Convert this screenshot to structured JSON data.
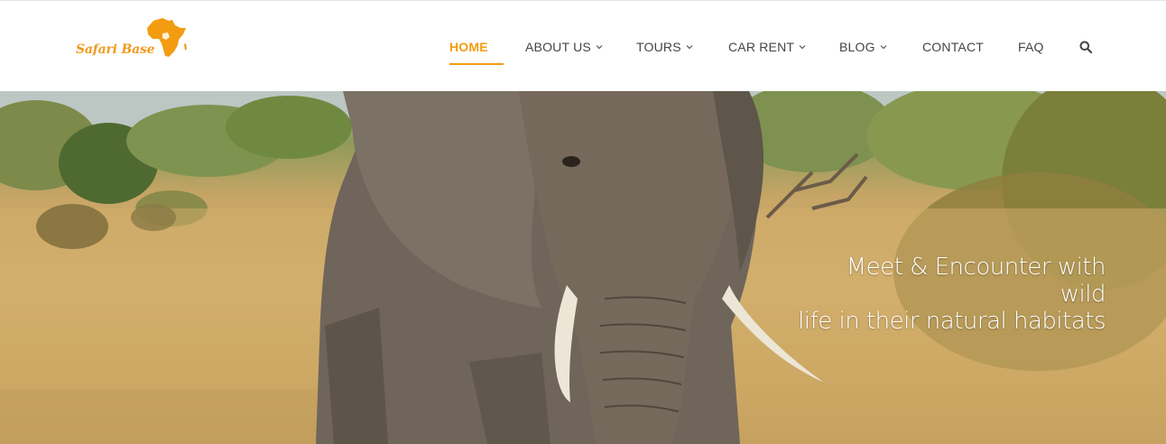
{
  "brand": {
    "name": "Safari Base",
    "accent_color": "#f39c12"
  },
  "nav": {
    "items": [
      {
        "label": "HOME",
        "active": true,
        "has_dropdown": false
      },
      {
        "label": "ABOUT US",
        "active": false,
        "has_dropdown": true
      },
      {
        "label": "TOURS",
        "active": false,
        "has_dropdown": true
      },
      {
        "label": "CAR RENT",
        "active": false,
        "has_dropdown": true
      },
      {
        "label": "BLOG",
        "active": false,
        "has_dropdown": true
      },
      {
        "label": "CONTACT",
        "active": false,
        "has_dropdown": false
      },
      {
        "label": "FAQ",
        "active": false,
        "has_dropdown": false
      }
    ],
    "search_icon": "search-icon",
    "dropdown_icon": "chevron-down-icon"
  },
  "hero": {
    "tagline_line1": "Meet & Encounter with wild",
    "tagline_line2": "life in their natural habitats",
    "image_subject": "elephant in savanna"
  }
}
